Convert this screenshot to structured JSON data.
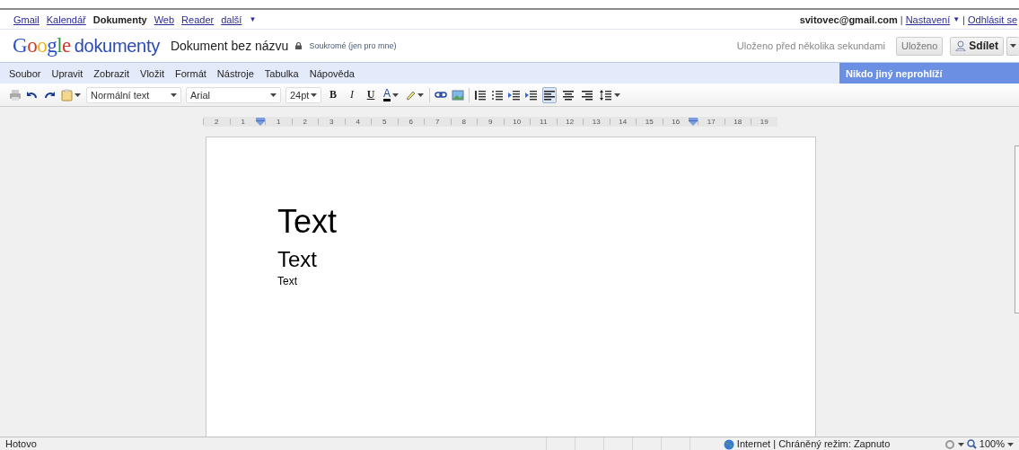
{
  "nav": {
    "links": [
      {
        "label": "Gmail",
        "selected": false
      },
      {
        "label": "Kalendář",
        "selected": false
      },
      {
        "label": "Dokumenty",
        "selected": true
      },
      {
        "label": "Web",
        "selected": false
      },
      {
        "label": "Reader",
        "selected": false
      },
      {
        "label": "další",
        "selected": false
      }
    ],
    "more_arrow": "▼",
    "account": "svitovec@gmail.com",
    "separator_1": "|",
    "settings": "Nastavení",
    "settings_arrow": "▼",
    "separator_2": "|",
    "sign_out": "Odhlásit se"
  },
  "header": {
    "logo": "Google",
    "product": "dokumenty",
    "document_title": "Dokument bez názvu",
    "privacy": "Soukromé (jen pro mne)",
    "save_status": "Uloženo před několika sekundami",
    "saved_button": "Uloženo",
    "share_button": "Sdílet"
  },
  "menu": {
    "items": [
      "Soubor",
      "Upravit",
      "Zobrazit",
      "Vložit",
      "Formát",
      "Nástroje",
      "Tabulka",
      "Nápověda"
    ],
    "viewers": "Nikdo jiný neprohlíží"
  },
  "toolbar": {
    "style": "Normální text",
    "font": "Arial",
    "size": "24pt",
    "bold": "B",
    "italic": "I",
    "underline": "U",
    "text_color": "A",
    "alignment": [
      {
        "selected": true
      },
      {
        "selected": false
      },
      {
        "selected": false
      }
    ]
  },
  "ruler": {
    "items": [
      {
        "kind": "number",
        "label": "2"
      },
      {
        "kind": "number",
        "label": "1"
      },
      {
        "kind": "marker"
      },
      {
        "kind": "number",
        "label": "1"
      },
      {
        "kind": "number",
        "label": "2"
      },
      {
        "kind": "number",
        "label": "3"
      },
      {
        "kind": "number",
        "label": "4"
      },
      {
        "kind": "number",
        "label": "5"
      },
      {
        "kind": "number",
        "label": "6"
      },
      {
        "kind": "number",
        "label": "7"
      },
      {
        "kind": "number",
        "label": "8"
      },
      {
        "kind": "number",
        "label": "9"
      },
      {
        "kind": "number",
        "label": "10"
      },
      {
        "kind": "number",
        "label": "11"
      },
      {
        "kind": "number",
        "label": "12"
      },
      {
        "kind": "number",
        "label": "13"
      },
      {
        "kind": "number",
        "label": "14"
      },
      {
        "kind": "number",
        "label": "15"
      },
      {
        "kind": "number",
        "label": "16"
      },
      {
        "kind": "marker"
      },
      {
        "kind": "number",
        "label": "17"
      },
      {
        "kind": "number",
        "label": "18"
      },
      {
        "kind": "number",
        "label": "19"
      }
    ]
  },
  "document": {
    "paragraphs": [
      {
        "kind": "large",
        "text": "Text"
      },
      {
        "kind": "medium",
        "text": "Text"
      },
      {
        "kind": "normal",
        "text": "Text"
      }
    ]
  },
  "status_bar": {
    "status": "Hotovo",
    "zone": "Internet | Chráněný režim: Zapnuto",
    "zoom": "100%"
  }
}
